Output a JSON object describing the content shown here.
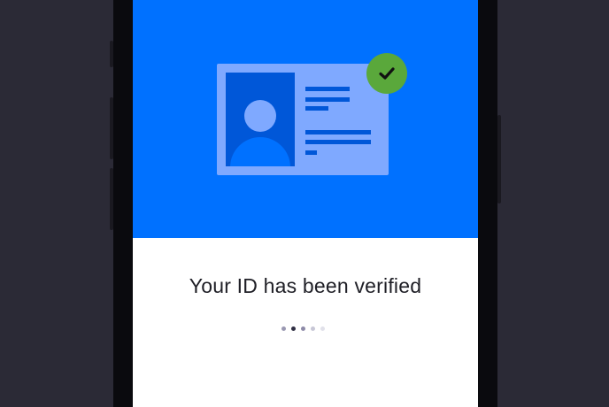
{
  "screen": {
    "title": "Your ID has been verified",
    "carousel": {
      "total_pages": 5,
      "active_page": 2
    }
  },
  "illustration": {
    "card_icon": "id-card-icon",
    "badge_icon": "checkmark-icon",
    "colors": {
      "hero_background": "#0071ff",
      "card": "#7fa9ff",
      "card_accent": "#0057d8",
      "verified_badge": "#5aa83b"
    }
  },
  "colors": {
    "page_background": "#2b2a36",
    "screen_background": "#ffffff",
    "title_text": "#1f1f26"
  }
}
